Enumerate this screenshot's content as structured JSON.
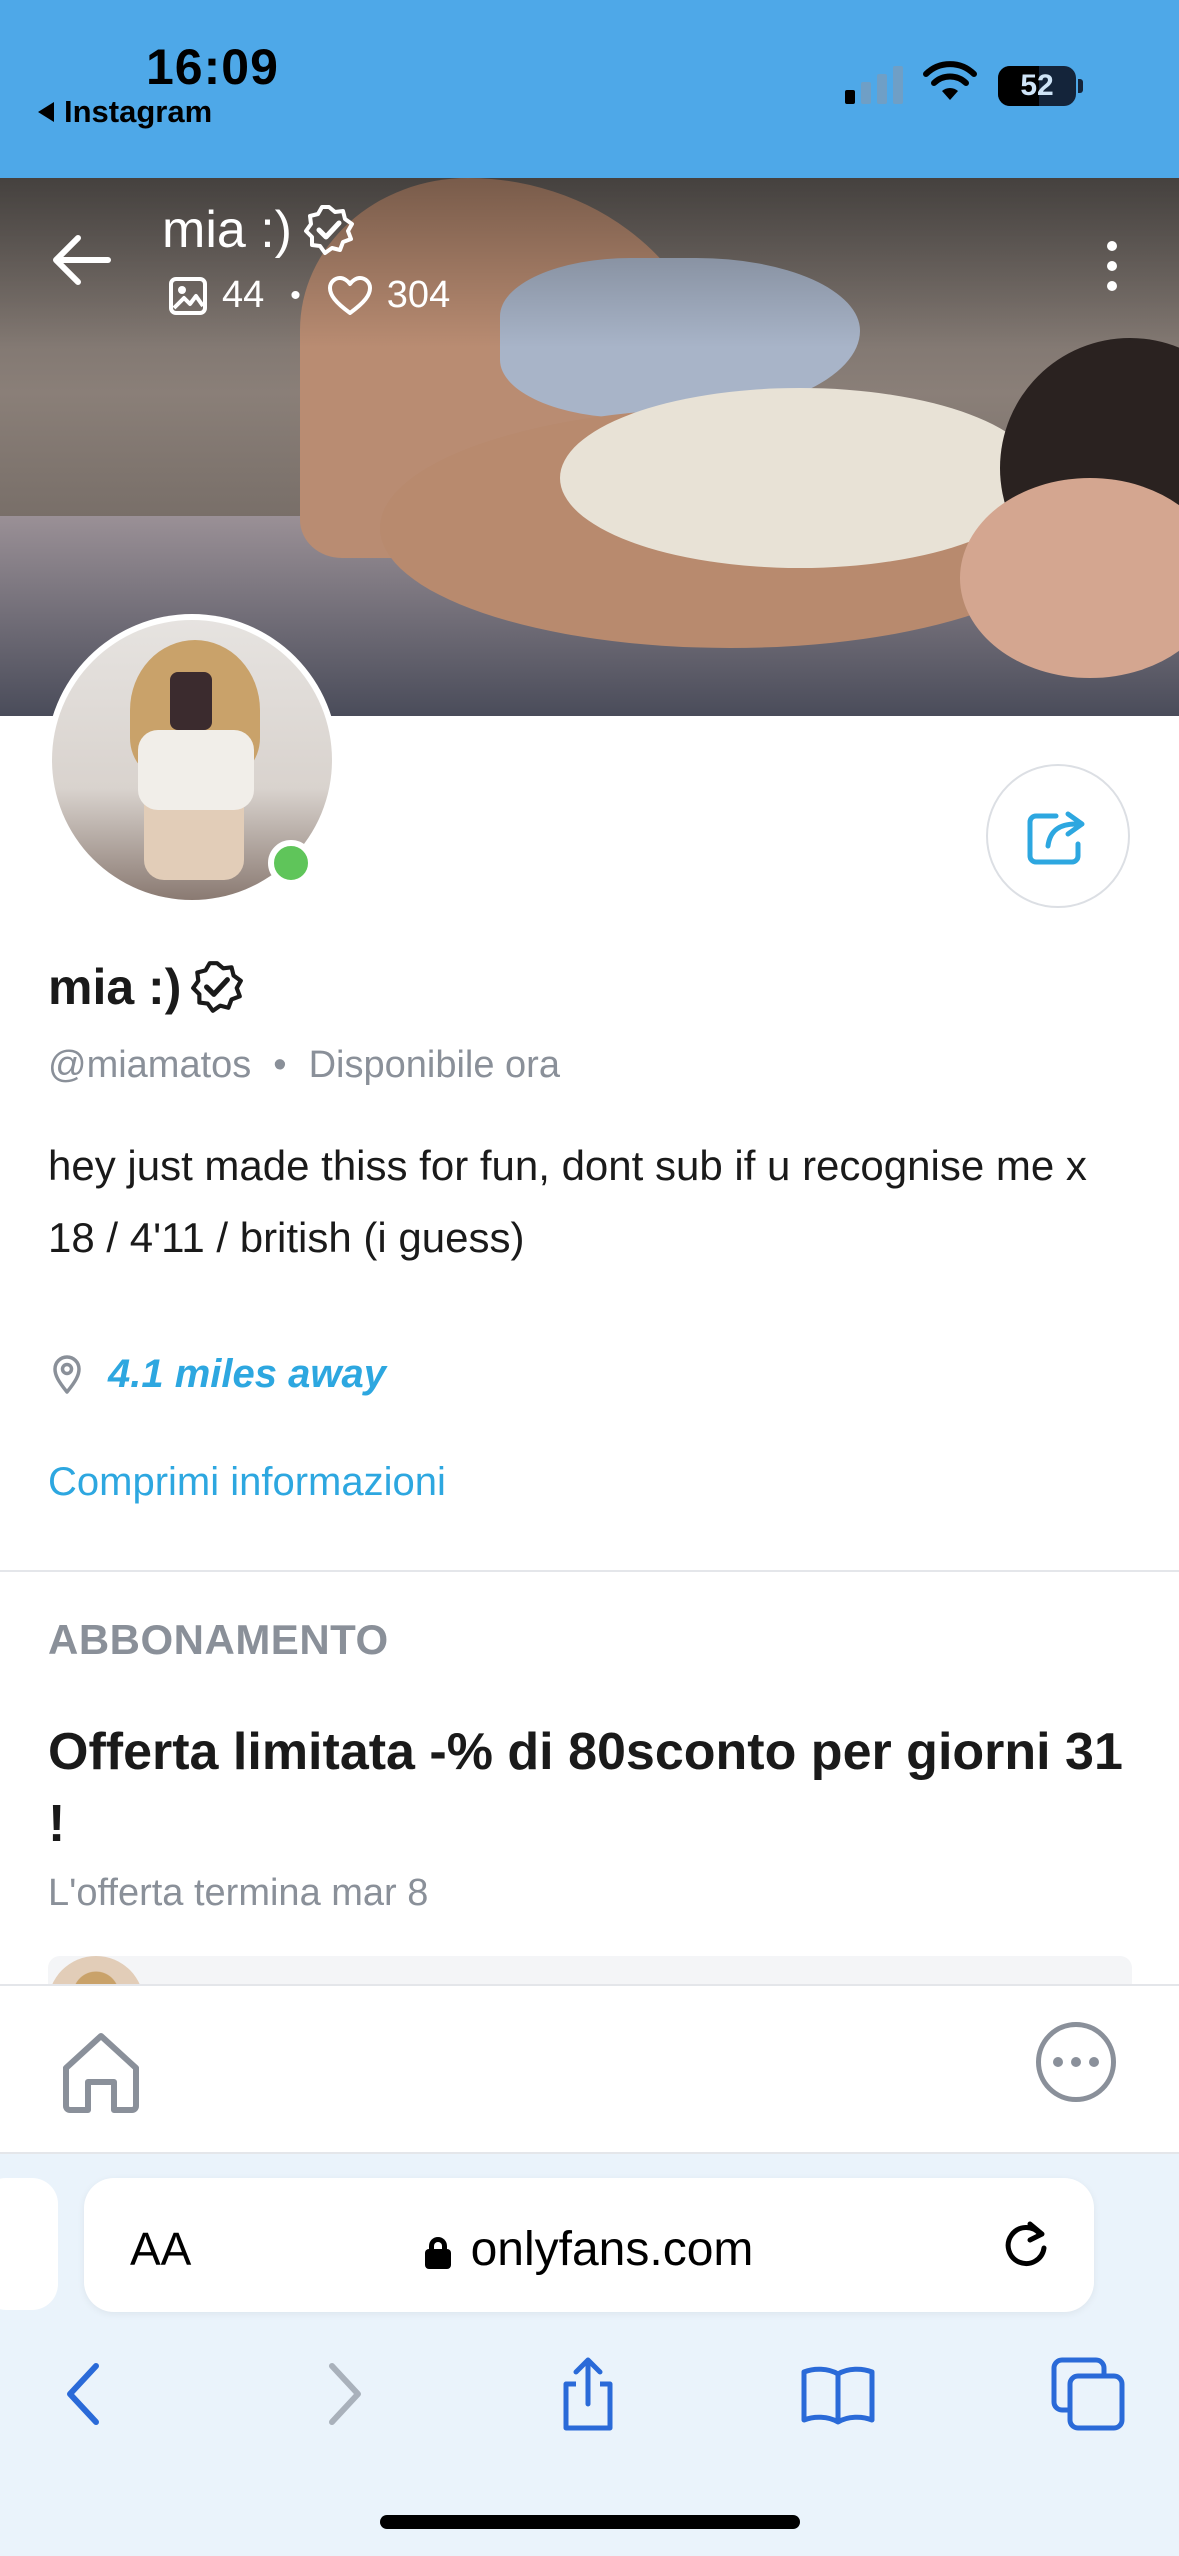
{
  "status_bar": {
    "time": "16:09",
    "back_app": "Instagram",
    "battery": "52",
    "battery_level": 0.52
  },
  "header": {
    "title": "mia :)",
    "media_count": "44",
    "likes_count": "304"
  },
  "profile": {
    "name": "mia :)",
    "handle": "@miamatos",
    "availability": "Disponibile ora",
    "bio_line1": "hey just made thiss for fun, dont sub if u recognise me x",
    "bio_line2": "18 / 4'11 / british (i guess)",
    "location": "4.1 miles away",
    "more_info": "Comprimi informazioni"
  },
  "subscription": {
    "section_title": "ABBONAMENTO",
    "offer_title": "Offerta limitata -% di 80sconto per giorni 31 !",
    "offer_end": "L'offerta termina mar 8"
  },
  "browser": {
    "text_size": "AA",
    "url": "onlyfans.com"
  },
  "colors": {
    "status_bar_bg": "#4ea8e8",
    "accent": "#2da7e0",
    "online": "#5fc55a",
    "muted": "#8a9099"
  },
  "icons": [
    "back-arrow-icon",
    "verified-badge-icon",
    "image-icon",
    "heart-icon",
    "more-vertical-icon",
    "share-icon",
    "location-pin-icon",
    "home-icon",
    "more-horizontal-icon",
    "lock-icon",
    "reload-icon",
    "back-icon",
    "forward-icon",
    "share-sheet-icon",
    "bookmarks-icon",
    "tabs-icon"
  ]
}
